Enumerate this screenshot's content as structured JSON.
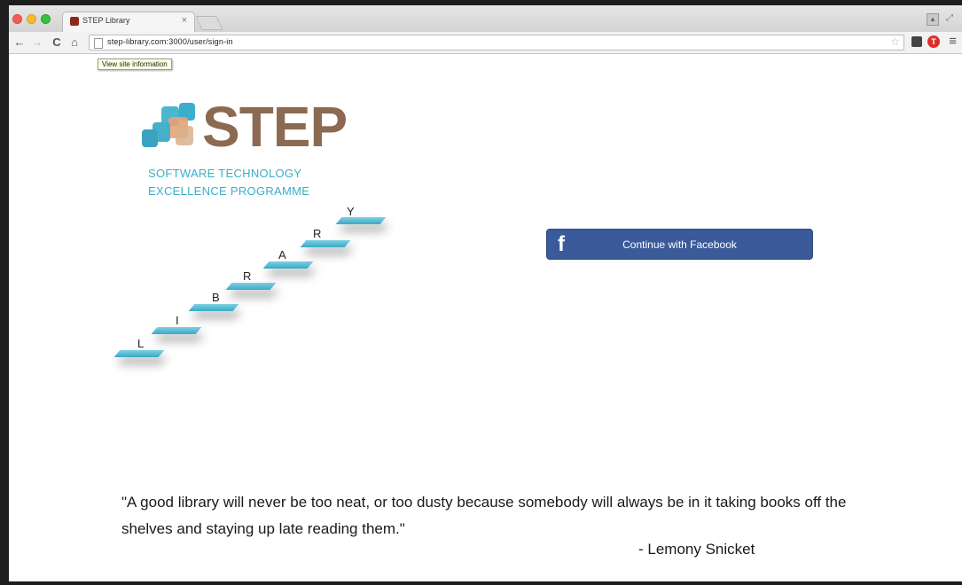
{
  "browser": {
    "tab_title": "STEP Library",
    "tab_close": "×",
    "back": "←",
    "forward": "→",
    "reload": "C",
    "home": "⌂",
    "url": "step-library.com:3000/user/sign-in",
    "star": "☆",
    "ext_badge": "T",
    "menu": "≡",
    "tooltip": "View site information"
  },
  "logo": {
    "word": "STEP",
    "line1": "SOFTWARE TECHNOLOGY",
    "line2": "EXCELLENCE PROGRAMME",
    "brand_brown": "#8c6a52",
    "brand_teal": "#3aaecb"
  },
  "library_letters": [
    "L",
    "I",
    "B",
    "R",
    "A",
    "R",
    "Y"
  ],
  "facebook_button": {
    "icon": "f",
    "label": "Continue with Facebook",
    "color": "#3b5a9a"
  },
  "quote": {
    "text": "\"A good library will never be too neat, or too dusty because somebody will always be in it taking books off the shelves and staying up late reading them.\"",
    "author": "- Lemony Snicket"
  }
}
